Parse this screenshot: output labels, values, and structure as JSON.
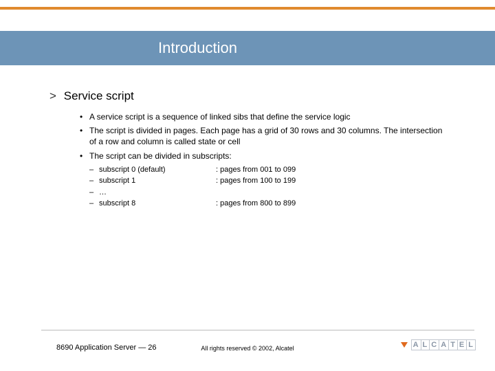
{
  "title": "Introduction",
  "heading": {
    "chevron": ">",
    "text": "Service script"
  },
  "bullets": [
    "A service script is a sequence of linked sibs that define the service logic",
    "The script is divided in pages. Each page has a grid of 30 rows and 30 columns. The intersection of a row and column is called state or cell",
    "The script can be divided in subscripts:"
  ],
  "subscripts": [
    {
      "dash": "–",
      "label": "subscript 0 (default)",
      "desc": ": pages from 001 to 099"
    },
    {
      "dash": "–",
      "label": "subscript 1",
      "desc": ": pages from 100 to 199"
    },
    {
      "dash": "–",
      "label": "…",
      "desc": ""
    },
    {
      "dash": "–",
      "label": "subscript 8",
      "desc": ": pages from 800 to 899"
    }
  ],
  "footer": {
    "left": "8690 Application Server — 26",
    "center": "All rights reserved © 2002, Alcatel"
  },
  "logo": {
    "letters": [
      "A",
      "L",
      "C",
      "A",
      "T",
      "E",
      "L"
    ]
  }
}
